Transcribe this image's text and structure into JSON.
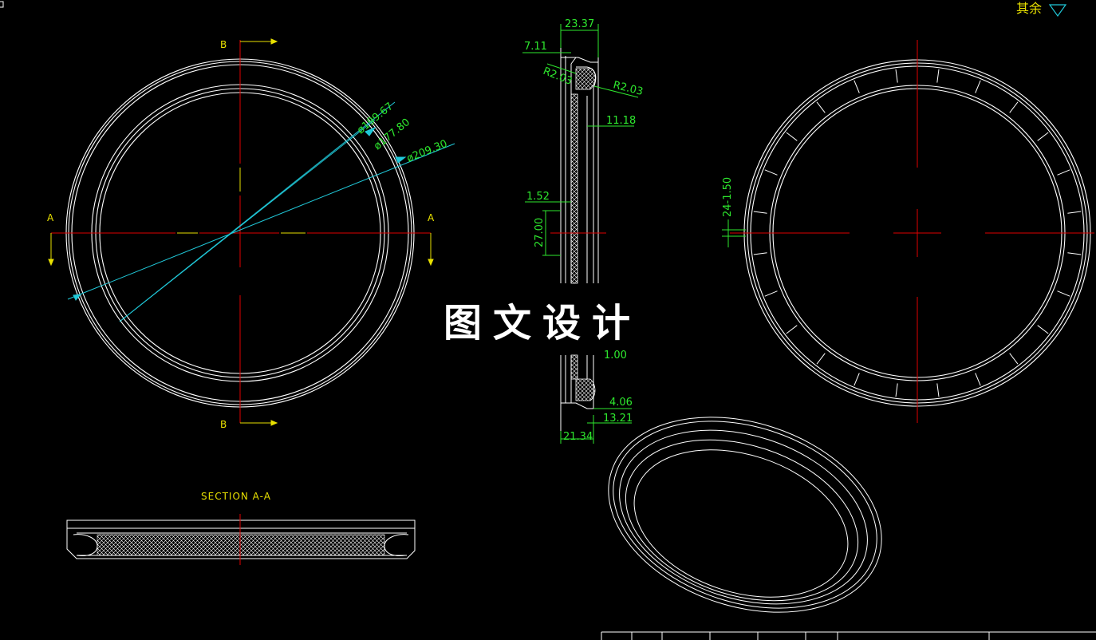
{
  "corner_note": "其余",
  "front_view": {
    "section_label_top": "B",
    "section_label_bottom": "B",
    "section_label_left": "A",
    "section_label_right": "A",
    "dim_1": "ø199.67",
    "dim_2": "ø177.80",
    "dim_3": "ø209.30"
  },
  "section_b": {
    "dim_width": "23.37",
    "dim_lip": "7.11",
    "dim_radius_left": "R2.03",
    "dim_radius_right": "R2.03",
    "dim_groove": "11.18",
    "dim_wall": "1.52",
    "dim_height": "27.00",
    "dim_partial": "1.00",
    "dim_step": "4.06",
    "dim_inner": "13.21",
    "dim_base": "21.34"
  },
  "rear_view": {
    "dim_vertical": "24-1.50"
  },
  "section_a": {
    "title": "SECTION A-A"
  },
  "watermark": "图文设计",
  "colors": {
    "background": "#000000",
    "outline": "#ffffff",
    "centerline": "#e00000",
    "dimension": "#2ee82e",
    "leader": "#20c8d8",
    "label": "#e8e000"
  }
}
